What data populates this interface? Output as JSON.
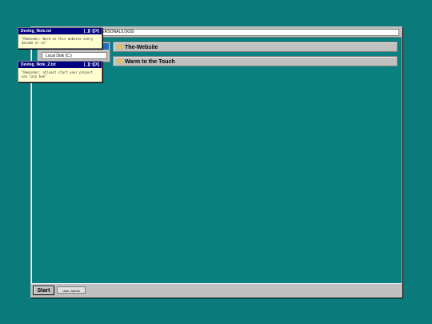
{
  "address": {
    "path": "PERSONAL/LOGS\\"
  },
  "tree": {
    "selected_label": "",
    "item_label": "Local Disk (C:)"
  },
  "folders": [
    {
      "name": "The-Website"
    },
    {
      "name": "Warm to the Touch"
    }
  ],
  "taskbar": {
    "start_label": "Start",
    "user_label": "User: Admin"
  },
  "notes": [
    {
      "title": "Devlog_Note.txt",
      "controls": "[_][□][X]",
      "text": "\"Reminder: Work on this website every decade or so\""
    },
    {
      "title": "Devlog_Note_2.txt",
      "controls": "[_][□][X]",
      "text": "\"Reminder: atleast start your project you lazy bum\""
    }
  ],
  "colors": {
    "desktop": "#0a7a7a",
    "titlebar": "#000080",
    "note_bg": "#ffffd0"
  }
}
